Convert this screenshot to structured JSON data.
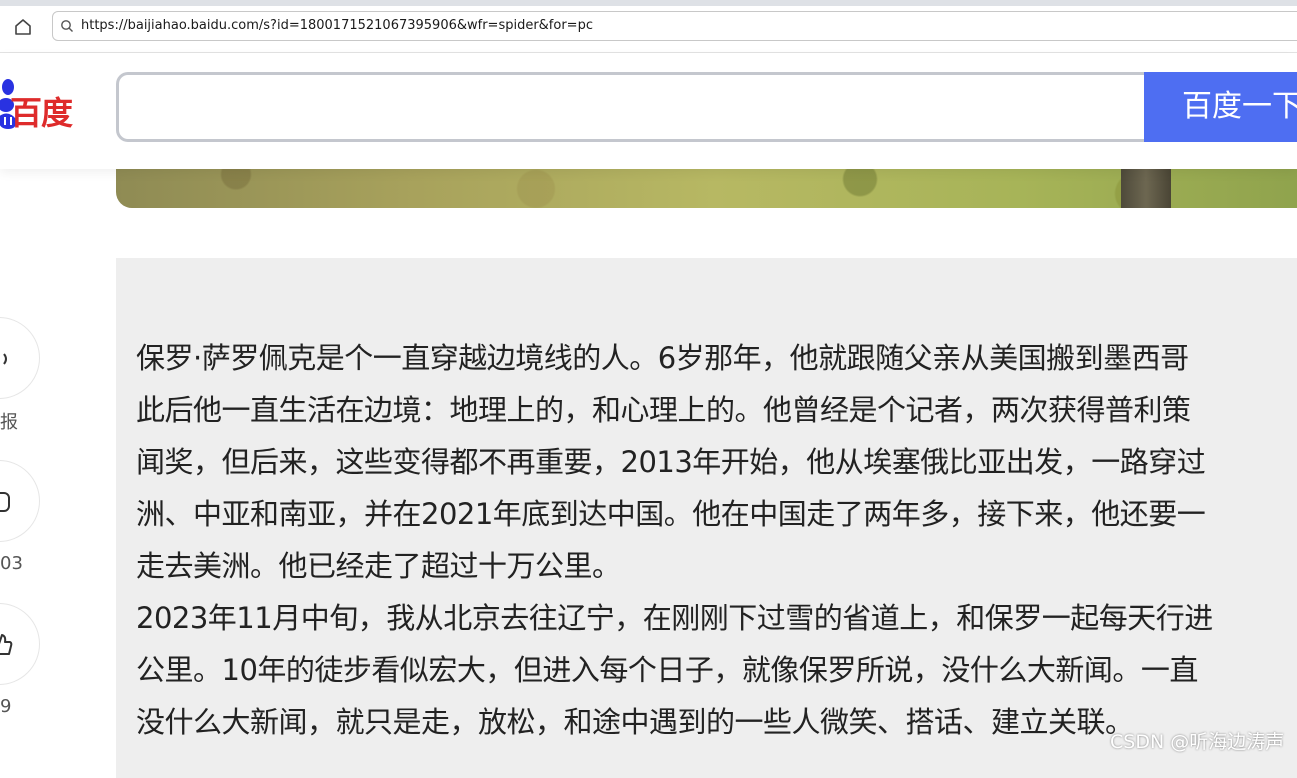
{
  "browser": {
    "url": "https://baijiahao.baidu.com/s?id=1800171521067395906&wfr=spider&for=pc"
  },
  "header": {
    "logo_text": "百度",
    "search_placeholder": "",
    "search_button": "百度一下"
  },
  "sidebar": {
    "items": [
      {
        "icon": "audio-icon",
        "label": "报"
      },
      {
        "icon": "comment-icon",
        "label": "03"
      },
      {
        "icon": "like-icon",
        "label": "9"
      }
    ]
  },
  "article": {
    "paragraphs": [
      {
        "lines": [
          "保罗·萨罗佩克是个一直穿越边境线的人。6岁那年，他就跟随父亲从美国搬到墨西哥",
          "此后他一直生活在边境：地理上的，和心理上的。他曾经是个记者，两次获得普利策",
          "闻奖，但后来，这些变得都不再重要，2013年开始，他从埃塞俄比亚出发，一路穿过",
          "洲、中亚和南亚，并在2021年底到达中国。他在中国走了两年多，接下来，他还要一",
          "走去美洲。他已经走了超过十万公里。"
        ]
      },
      {
        "lines": [
          "2023年11月中旬，我从北京去往辽宁，在刚刚下过雪的省道上，和保罗一起每天行进",
          "公里。10年的徒步看似宏大，但进入每个日子，就像保罗所说，没什么大新闻。一直",
          "没什么大新闻，就只是走，放松，和途中遇到的一些人微笑、搭话、建立关联。"
        ]
      }
    ]
  },
  "watermark": "CSDN @听海边涛声"
}
